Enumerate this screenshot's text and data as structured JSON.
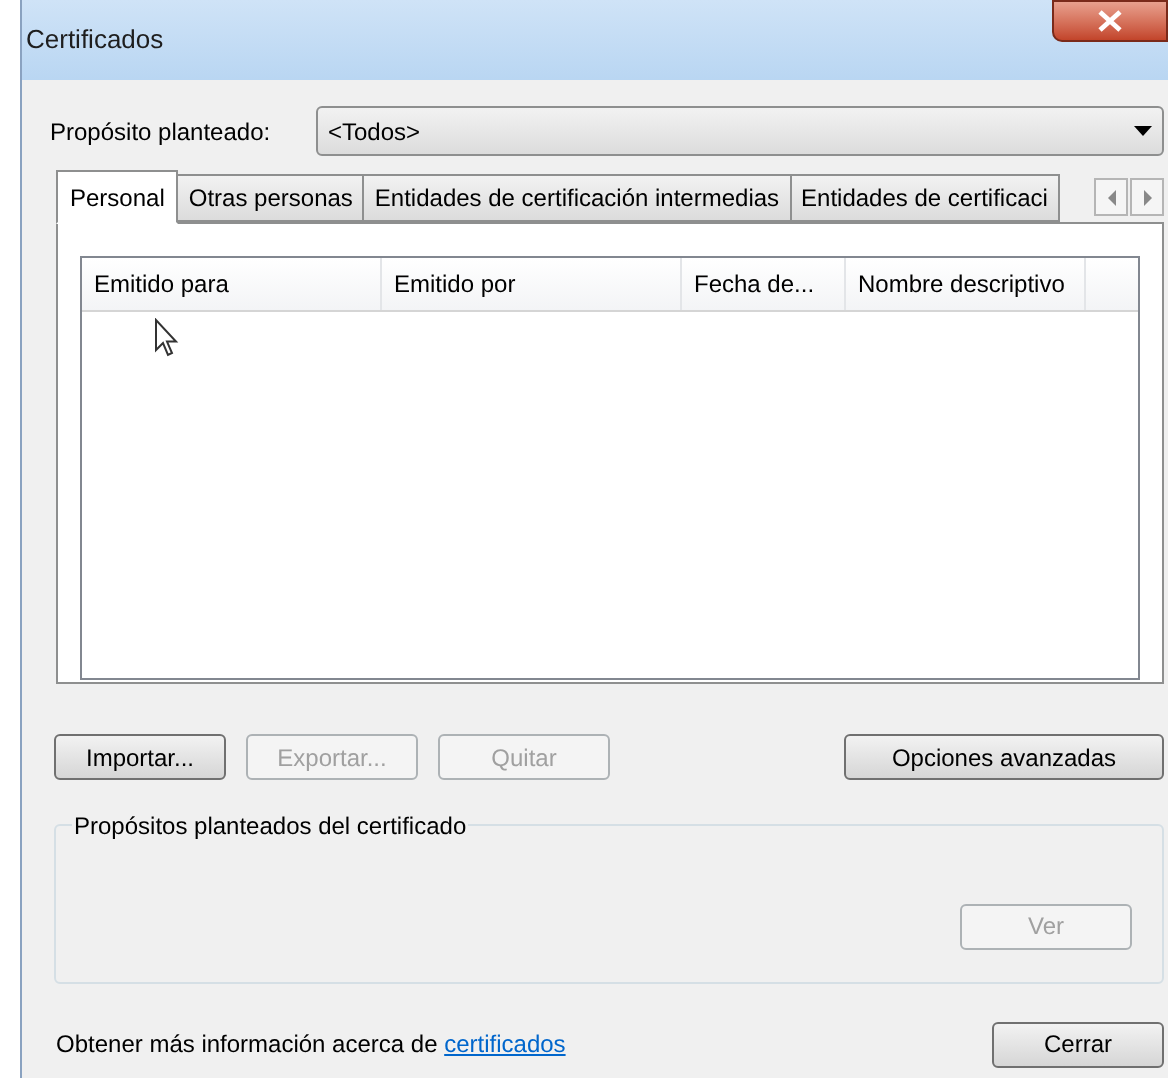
{
  "window": {
    "title": "Certificados"
  },
  "purpose": {
    "label": "Propósito planteado:",
    "value": "<Todos>"
  },
  "tabs": [
    {
      "label": "Personal",
      "selected": true
    },
    {
      "label": "Otras personas",
      "selected": false
    },
    {
      "label": "Entidades de certificación intermedias",
      "selected": false
    },
    {
      "label": "Entidades de certificaci",
      "selected": false
    }
  ],
  "table": {
    "columns": [
      "Emitido para",
      "Emitido por",
      "Fecha de...",
      "Nombre descriptivo"
    ]
  },
  "buttons": [
    {
      "label": "Importar...",
      "disabled": false
    },
    {
      "label": "Exportar...",
      "disabled": true
    },
    {
      "label": "Quitar",
      "disabled": true
    }
  ],
  "advanced_button": {
    "label": "Opciones avanzadas",
    "disabled": false
  },
  "purposes_group": {
    "title": "Propósitos planteados del certificado",
    "view_button": {
      "label": "Ver",
      "disabled": true
    }
  },
  "footer": {
    "text": "Obtener más información acerca de ",
    "link": "certificados"
  },
  "close_button": {
    "label": "Cerrar",
    "disabled": false
  }
}
